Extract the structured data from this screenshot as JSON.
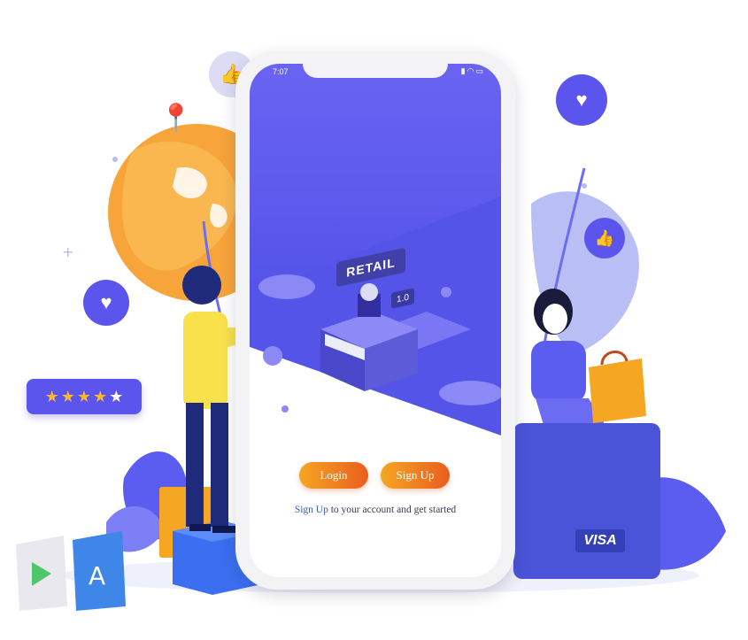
{
  "colors": {
    "primary": "#5b5cf0",
    "accent_orange": "#f5a623",
    "globe_orange": "#f7a43a",
    "bubble": "#5b55ee",
    "card": "#4a54d8"
  },
  "status_bar": {
    "time": "7:07",
    "icons": [
      "signal-icon",
      "wifi-icon",
      "battery-icon"
    ]
  },
  "hero": {
    "sign_text": "RETAIL",
    "version_text": "1.0"
  },
  "actions": {
    "login_label": "Login",
    "signup_label": "Sign Up"
  },
  "tagline": {
    "link_text": "Sign Up",
    "rest_text": "to your account and get started"
  },
  "rating": {
    "stars_filled": 3.5,
    "stars_total": 5
  },
  "card": {
    "brand": "VISA"
  },
  "icons": [
    "thumbs-up-icon",
    "heart-icon",
    "location-pin-icon",
    "star-icon",
    "shopping-bag-icon",
    "google-play-bag-icon",
    "app-store-bag-icon"
  ]
}
